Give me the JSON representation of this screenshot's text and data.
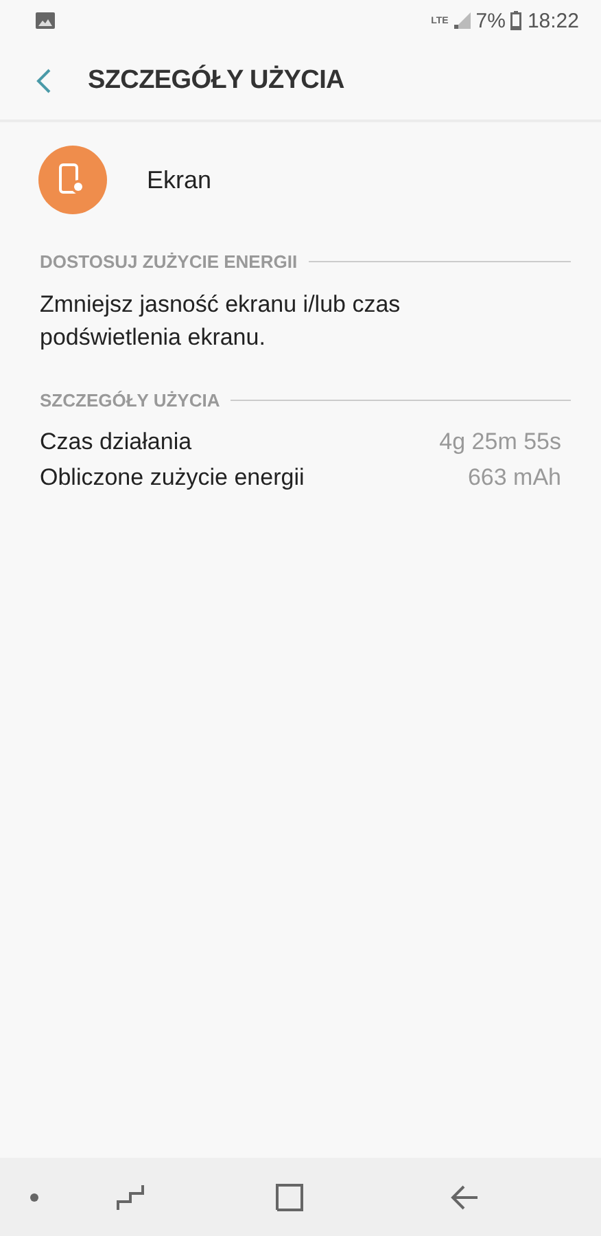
{
  "status_bar": {
    "network": "LTE",
    "battery": "7%",
    "time": "18:22"
  },
  "header": {
    "title": "SZCZEGÓŁY UŻYCIA"
  },
  "app": {
    "name": "Ekran"
  },
  "sections": [
    {
      "title": "DOSTOSUJ ZUŻYCIE ENERGII",
      "text": "Zmniejsz jasność ekranu i/lub czas podświetlenia ekranu."
    },
    {
      "title": "SZCZEGÓŁY UŻYCIA",
      "rows": [
        {
          "label": "Czas działania",
          "value": "4g 25m 55s"
        },
        {
          "label": "Obliczone zużycie energii",
          "value": "663 mAh"
        }
      ]
    }
  ]
}
